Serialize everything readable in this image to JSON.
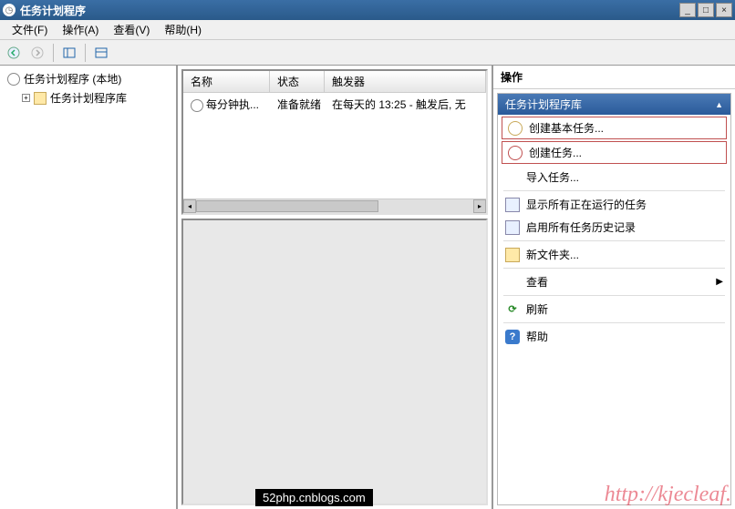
{
  "window": {
    "title": "任务计划程序"
  },
  "menu": {
    "file": "文件(F)",
    "action": "操作(A)",
    "view": "查看(V)",
    "help": "帮助(H)"
  },
  "tree": {
    "root": "任务计划程序 (本地)",
    "library": "任务计划程序库"
  },
  "list": {
    "cols": {
      "name": "名称",
      "status": "状态",
      "trigger": "触发器"
    },
    "rows": [
      {
        "name": "每分钟执...",
        "status": "准备就绪",
        "trigger": "在每天的 13:25 - 触发后, 无"
      }
    ]
  },
  "actions": {
    "title": "操作",
    "section": "任务计划程序库",
    "create_basic": "创建基本任务...",
    "create_task": "创建任务...",
    "import_task": "导入任务...",
    "show_running": "显示所有正在运行的任务",
    "enable_history": "启用所有任务历史记录",
    "new_folder": "新文件夹...",
    "view": "查看",
    "refresh": "刷新",
    "help": "帮助"
  },
  "watermark": {
    "a": "52php.cnblogs.com",
    "b": "http://kjecleaf."
  }
}
